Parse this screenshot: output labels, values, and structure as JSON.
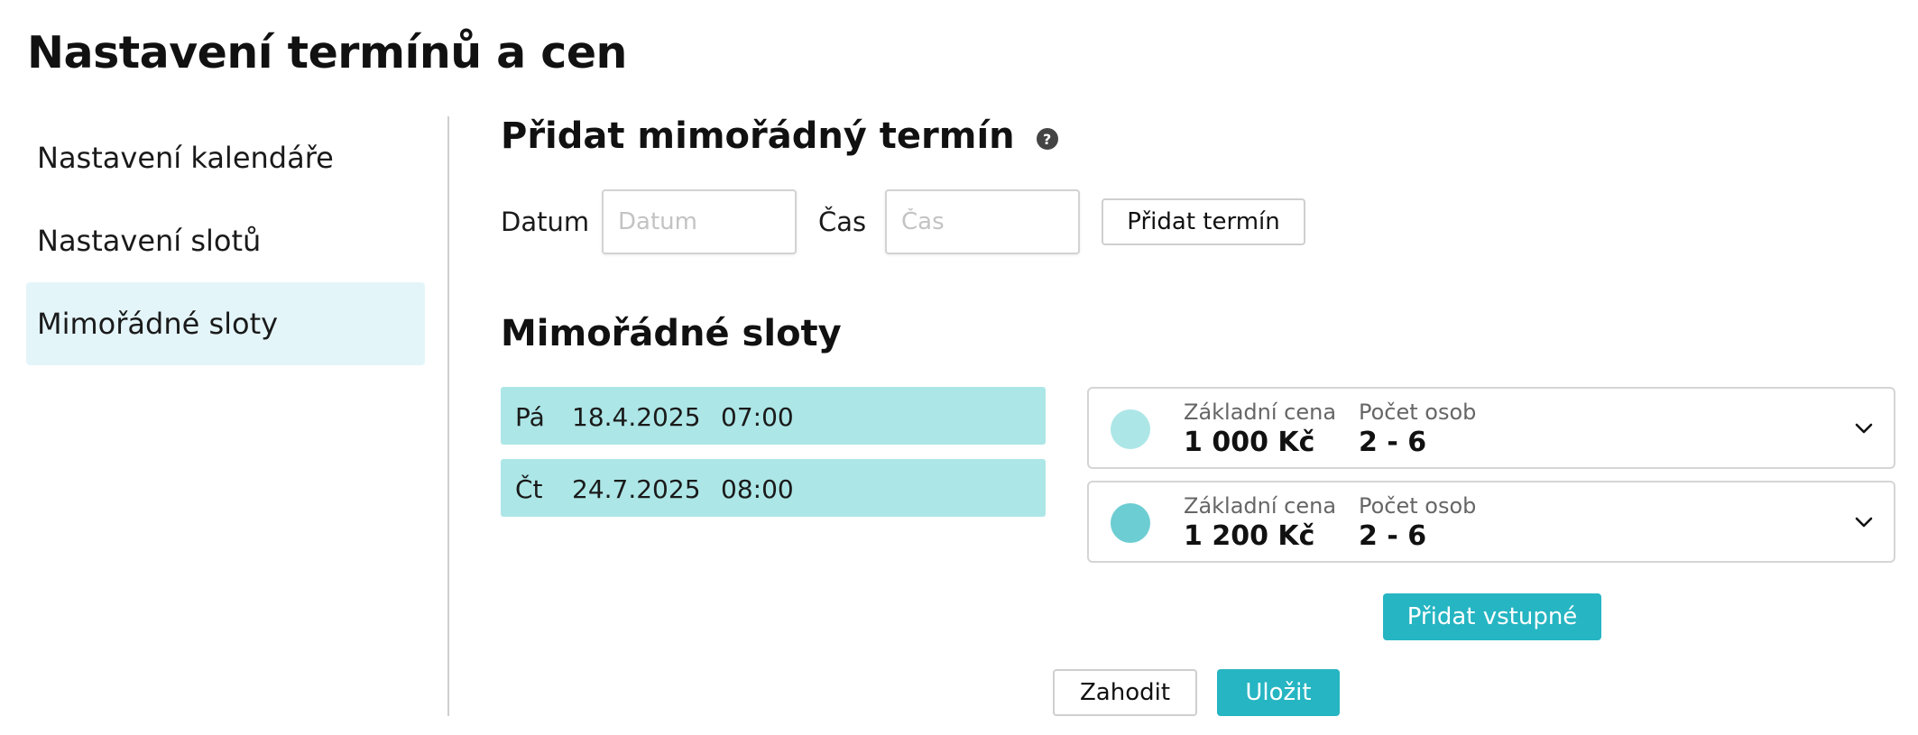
{
  "page": {
    "title": "Nastavení termínů a cen"
  },
  "sidebar": {
    "items": [
      {
        "label": "Nastavení kalendáře",
        "active": false
      },
      {
        "label": "Nastavení slotů",
        "active": false
      },
      {
        "label": "Mimořádné sloty",
        "active": true
      }
    ]
  },
  "add_slot": {
    "title": "Přidat mimořádný termín",
    "help_icon": "?",
    "date_label": "Datum",
    "date_placeholder": "Datum",
    "time_label": "Čas",
    "time_placeholder": "Čas",
    "add_button": "Přidat termín"
  },
  "slots": {
    "title": "Mimořádné sloty",
    "rows": [
      {
        "day": "Pá",
        "date": "18.4.2025",
        "time": "07:00"
      },
      {
        "day": "Čt",
        "date": "24.7.2025",
        "time": "08:00"
      }
    ]
  },
  "prices": {
    "cards": [
      {
        "base_label": "Základní cena",
        "base_value": "1 000 Kč",
        "persons_label": "Počet osob",
        "persons_value": "2 - 6",
        "color": "#ade6e6"
      },
      {
        "base_label": "Základní cena",
        "base_value": "1 200 Kč",
        "persons_label": "Počet osob",
        "persons_value": "2 - 6",
        "color": "#6ccdd2"
      }
    ],
    "add_button": "Přidat vstupné"
  },
  "footer": {
    "discard_label": "Zahodit",
    "save_label": "Uložit"
  },
  "colors": {
    "accent": "#26b5c2",
    "slot_bg": "#ade6e6",
    "sidebar_active_bg": "#e4f5fa"
  }
}
